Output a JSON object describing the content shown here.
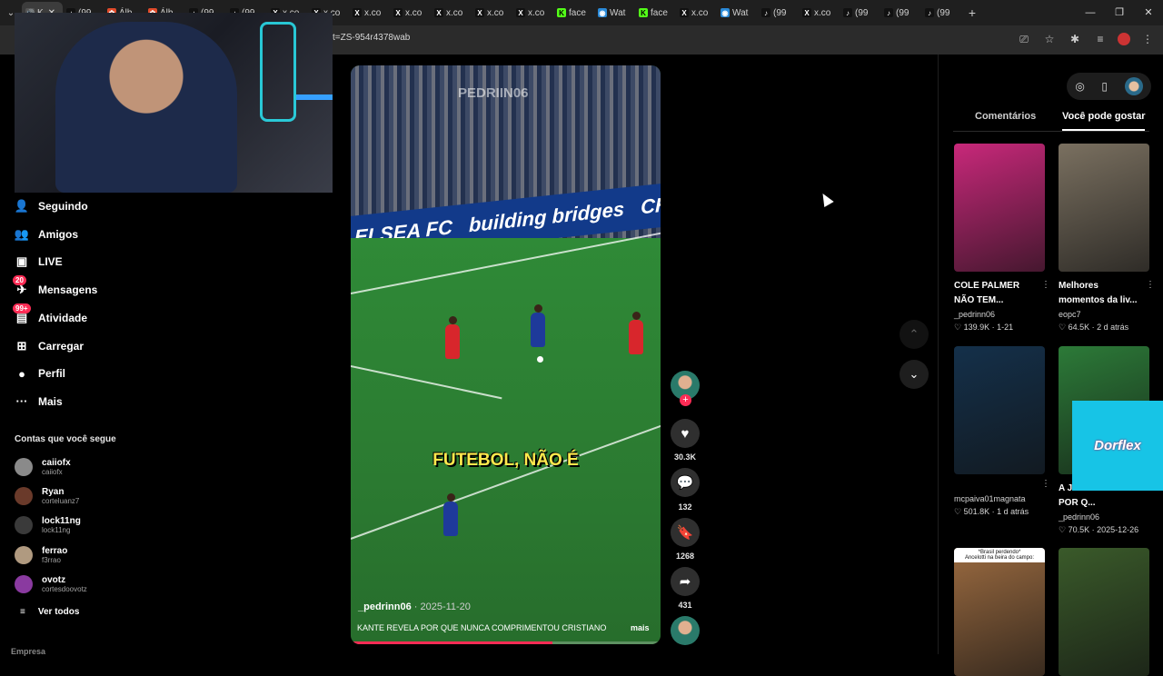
{
  "browser": {
    "tabs": [
      {
        "label": "K",
        "icon": "speaker-icon",
        "active": true
      },
      {
        "label": "(99",
        "icon": "tiktok-icon"
      },
      {
        "label": "Álb",
        "icon": "photos-icon"
      },
      {
        "label": "Álb",
        "icon": "photos-icon"
      },
      {
        "label": "(99",
        "icon": "tiktok-icon"
      },
      {
        "label": "(99",
        "icon": "tiktok-icon"
      },
      {
        "label": "x.co",
        "icon": "x-icon"
      },
      {
        "label": "x.co",
        "icon": "x-icon"
      },
      {
        "label": "x.co",
        "icon": "x-icon"
      },
      {
        "label": "x.co",
        "icon": "x-icon"
      },
      {
        "label": "x.co",
        "icon": "x-icon"
      },
      {
        "label": "x.co",
        "icon": "x-icon"
      },
      {
        "label": "x.co",
        "icon": "x-icon"
      },
      {
        "label": "face",
        "icon": "kick-icon"
      },
      {
        "label": "Wat",
        "icon": "watch-icon"
      },
      {
        "label": "face",
        "icon": "kick-icon"
      },
      {
        "label": "x.co",
        "icon": "x-icon"
      },
      {
        "label": "Wat",
        "icon": "watch-icon"
      },
      {
        "label": "(99",
        "icon": "tiktok-icon"
      },
      {
        "label": "x.co",
        "icon": "x-icon"
      },
      {
        "label": "(99",
        "icon": "tiktok-icon"
      },
      {
        "label": "(99",
        "icon": "tiktok-icon"
      },
      {
        "label": "(99",
        "icon": "tiktok-icon"
      }
    ],
    "url": "t=ZS-954r4378wab"
  },
  "sidebar": {
    "nav": [
      {
        "label": "Seguindo",
        "icon": "following-icon",
        "badge": ""
      },
      {
        "label": "Amigos",
        "icon": "friends-icon",
        "badge": ""
      },
      {
        "label": "LIVE",
        "icon": "live-icon",
        "badge": ""
      },
      {
        "label": "Mensagens",
        "icon": "messages-icon",
        "badge": "20"
      },
      {
        "label": "Atividade",
        "icon": "activity-icon",
        "badge": "99+"
      },
      {
        "label": "Carregar",
        "icon": "upload-icon",
        "badge": ""
      },
      {
        "label": "Perfil",
        "icon": "profile-icon",
        "badge": ""
      },
      {
        "label": "Mais",
        "icon": "more-icon",
        "badge": ""
      }
    ],
    "following_title": "Contas que você segue",
    "accounts": [
      {
        "name": "caiiofx",
        "handle": "caiiofx",
        "color": "#8a8a8a"
      },
      {
        "name": "Ryan",
        "handle": "corteluanz7",
        "color": "#6a3a2a"
      },
      {
        "name": "lock11ng",
        "handle": "lock11ng",
        "color": "#3a3a3a"
      },
      {
        "name": "ferrao",
        "handle": "f3rrao",
        "color": "#b09a80"
      },
      {
        "name": "ovotz",
        "handle": "cortesdoovotz",
        "color": "#8a3aa0"
      }
    ],
    "see_all": "Ver todos",
    "footer": "Empresa"
  },
  "video": {
    "watermark": "PEDRIIN06",
    "board_text": [
      "ELSEA FC",
      "building bridges",
      "CHE"
    ],
    "caption": "FUTEBOL, NÃO É",
    "author": "_pedrinn06",
    "date": "· 2025-11-20",
    "description": "KANTE REVELA POR QUE NUNCA COMPRIMENTOU CRISTIANO",
    "more": "mais",
    "progress": 0.65
  },
  "actions": {
    "likes": "30.3K",
    "comments": "132",
    "saves": "1268",
    "shares": "431"
  },
  "right_panel": {
    "tabs": [
      "Comentários",
      "Você pode gostar"
    ],
    "cards": [
      {
        "title": "COLE PALMER NÃO TEM...",
        "author": "_pedrinn06",
        "meta": "♡ 139.9K · 1-21",
        "bg": "#c8287a"
      },
      {
        "title": "Melhores momentos da liv...",
        "author": "eopc7",
        "meta": "♡ 64.5K · 2 d atrás",
        "bg": "#7a7060"
      },
      {
        "title": "",
        "author": "mcpaiva01magnata",
        "meta": "♡ 501.8K · 1 d atrás",
        "bg": "#14304a"
      },
      {
        "title": "A J... EXPLICA POR Q...",
        "author": "_pedrinn06",
        "meta": "♡ 70.5K · 2025-12-26",
        "bg": "#2c7a38"
      },
      {
        "title": "",
        "author": "",
        "meta": "",
        "bg": "#9a6a40",
        "overlay": "*Brasil perdendo*",
        "overlay2": "Ancelotti na beira do campo:"
      },
      {
        "title": "",
        "author": "",
        "meta": "",
        "bg": "#3a5a2a"
      }
    ],
    "ad_text": "Dorflex"
  }
}
